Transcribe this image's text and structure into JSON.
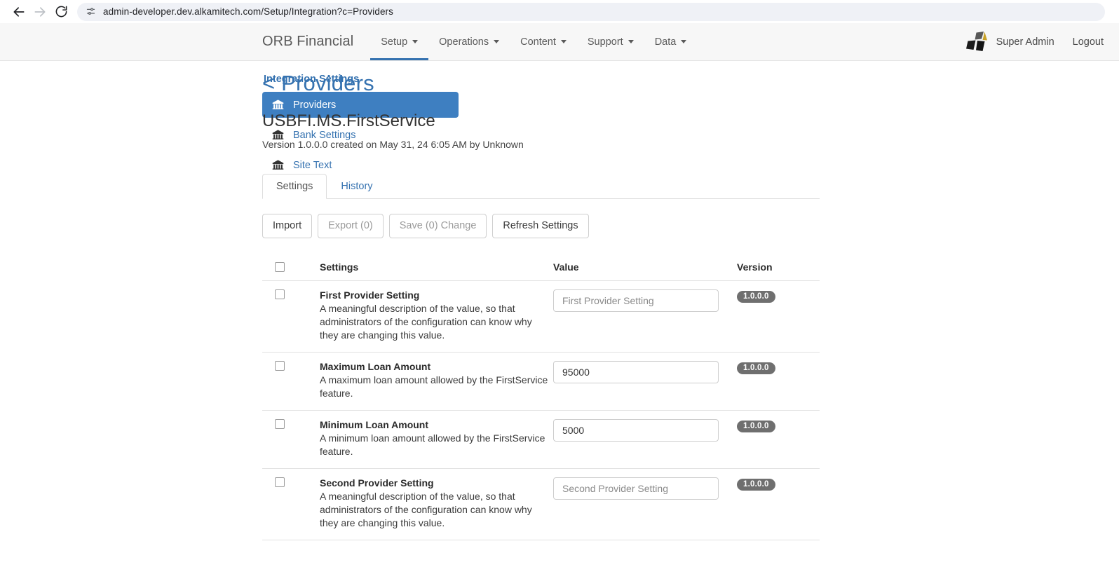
{
  "browser": {
    "back_icon": "back-arrow-icon",
    "forward_icon": "forward-arrow-icon",
    "reload_icon": "reload-icon",
    "site_settings_icon": "site-settings-icon",
    "url": "admin-developer.dev.alkamitech.com/Setup/Integration?c=Providers"
  },
  "topnav": {
    "brand": "ORB Financial",
    "items": [
      {
        "label": "Setup",
        "active": true
      },
      {
        "label": "Operations",
        "active": false
      },
      {
        "label": "Content",
        "active": false
      },
      {
        "label": "Support",
        "active": false
      },
      {
        "label": "Data",
        "active": false
      }
    ],
    "user_name": "Super Admin",
    "logout_label": "Logout",
    "accent_color": "#3572b0"
  },
  "sidebar": {
    "title": "Integration Settings",
    "items": [
      {
        "label": "Providers",
        "icon": "bank-icon",
        "active": true
      },
      {
        "label": "Bank Settings",
        "icon": "bank-icon",
        "active": false
      },
      {
        "label": "Site Text",
        "icon": "bank-icon",
        "active": false
      }
    ]
  },
  "main": {
    "breadcrumb": "< Providers",
    "entity_title": "USBFI.MS.FirstService",
    "entity_meta": "Version 1.0.0.0 created on May 31, 24 6:05 AM by Unknown",
    "tabs": [
      {
        "label": "Settings",
        "active": true
      },
      {
        "label": "History",
        "active": false
      }
    ],
    "toolbar": [
      {
        "label": "Import",
        "disabled": false
      },
      {
        "label": "Export (0)",
        "disabled": true
      },
      {
        "label": "Save (0) Change",
        "disabled": true
      },
      {
        "label": "Refresh Settings",
        "disabled": false
      }
    ],
    "table": {
      "columns": [
        "",
        "Settings",
        "Value",
        "Version"
      ],
      "select_all_checked": false,
      "rows": [
        {
          "checked": false,
          "name": "First Provider Setting",
          "description": "A meaningful description of the value, so that administrators of the configuration can know why they are changing this value.",
          "value": "",
          "placeholder": "First Provider Setting",
          "version": "1.0.0.0"
        },
        {
          "checked": false,
          "name": "Maximum Loan Amount",
          "description": "A maximum loan amount allowed by the FirstService feature.",
          "value": "95000",
          "placeholder": "",
          "version": "1.0.0.0"
        },
        {
          "checked": false,
          "name": "Minimum Loan Amount",
          "description": "A minimum loan amount allowed by the FirstService feature.",
          "value": "5000",
          "placeholder": "",
          "version": "1.0.0.0"
        },
        {
          "checked": false,
          "name": "Second Provider Setting",
          "description": "A meaningful description of the value, so that administrators of the configuration can know why they are changing this value.",
          "value": "",
          "placeholder": "Second Provider Setting",
          "version": "1.0.0.0"
        }
      ]
    }
  }
}
